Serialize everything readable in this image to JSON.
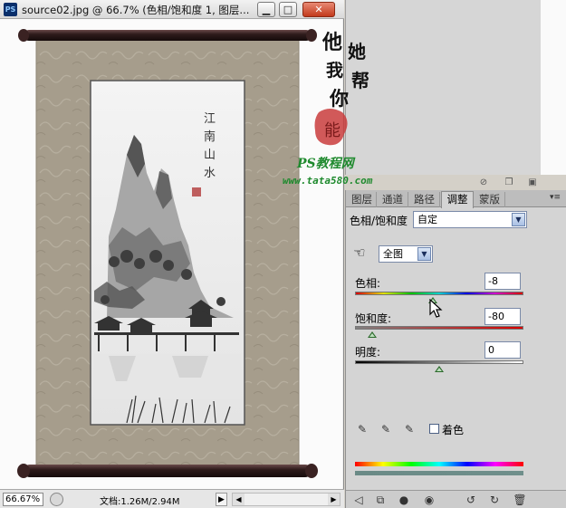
{
  "document_window": {
    "app_icon": "PS",
    "title": "source02.jpg @ 66.7% (色相/饱和度 1, 图层...",
    "buttons": {
      "minimize": "▁",
      "maximize": "□",
      "close": "✕"
    },
    "painting_inscription": [
      "江",
      "南",
      "山",
      "水"
    ],
    "status": {
      "zoom": "66.67%",
      "doc_size": "文档:1.26M/2.94M",
      "arrow": "▶"
    }
  },
  "watermark": {
    "calligraphy": [
      "他",
      "她",
      "我",
      "帮",
      "你"
    ],
    "seal": "能",
    "brand": "PS教程网",
    "url": "www.tata580.com"
  },
  "panel": {
    "tabs": [
      {
        "label": "图层"
      },
      {
        "label": "通道"
      },
      {
        "label": "路径"
      },
      {
        "label": "调整",
        "active": true
      },
      {
        "label": "蒙版"
      }
    ],
    "menu_icon": "▾≡",
    "adjustment_type": "色相/饱和度",
    "preset": "自定",
    "range": "全图",
    "hue": {
      "label": "色相:",
      "value": "-8",
      "slider_fraction": 0.46
    },
    "saturation": {
      "label": "饱和度:",
      "value": "-80",
      "slider_fraction": 0.1
    },
    "lightness": {
      "label": "明度:",
      "value": "0",
      "slider_fraction": 0.5
    },
    "colorize_label": "着色"
  },
  "icons": {
    "hand": "hand-target-icon",
    "eyedroppers": [
      "eyedropper-icon",
      "eyedropper-plus-icon",
      "eyedropper-minus-icon"
    ],
    "toolbar": [
      "back-arrow-icon",
      "expand-view-icon",
      "clip-layer-icon",
      "visibility-eye-icon",
      "view-previous-icon",
      "reset-icon",
      "trash-icon"
    ]
  }
}
